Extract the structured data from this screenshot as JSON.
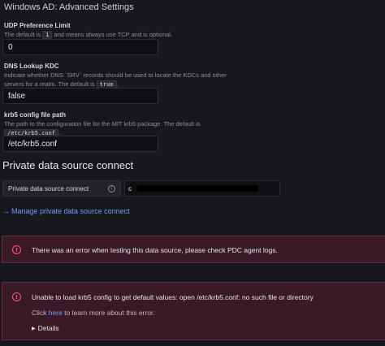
{
  "section_title": "Windows AD: Advanced Settings",
  "udp": {
    "label": "UDP Preference Limit",
    "desc_before": "The default is ",
    "desc_code": "1",
    "desc_after": " and means always use TCP and is optional.",
    "value": "0"
  },
  "dns": {
    "label": "DNS Lookup KDC",
    "desc_line1": "Indicate whether DNS `SRV` records should be used to locate the KDCs and other",
    "desc_line2_before": "servers for a realm. The default is ",
    "desc_code": "true",
    "desc_line2_after": ".",
    "value": "false"
  },
  "krb5": {
    "label": "krb5 config file path",
    "desc_line1": "The path to the configuration file for the MIT krb5 package. The default is",
    "desc_code": "/etc/krb5.conf",
    "desc_line2_after": ".",
    "value": "/etc/krb5.conf"
  },
  "pdc": {
    "title": "Private data source connect",
    "label": "Private data source connect",
    "info_glyph": "i",
    "select_prefix": "c",
    "manage_link": "Manage private data source connect",
    "manage_arrow": "→"
  },
  "alerts": [
    {
      "icon_glyph": "!",
      "message": "There was an error when testing this data source, please check PDC agent logs."
    },
    {
      "icon_glyph": "!",
      "message": "Unable to load krb5 config to get default values: open /etc/krb5.conf: no such file or directory",
      "sub_before": "Click ",
      "sub_link": "here",
      "sub_after": " to learn more about this error.",
      "details_label": "Details",
      "details_glyph": "▶"
    }
  ],
  "colors": {
    "background": "#17181c",
    "link": "#6e9fff",
    "error_bg": "#3b1a27",
    "error_border": "#6b2a3f",
    "error_icon": "#ff5286"
  }
}
